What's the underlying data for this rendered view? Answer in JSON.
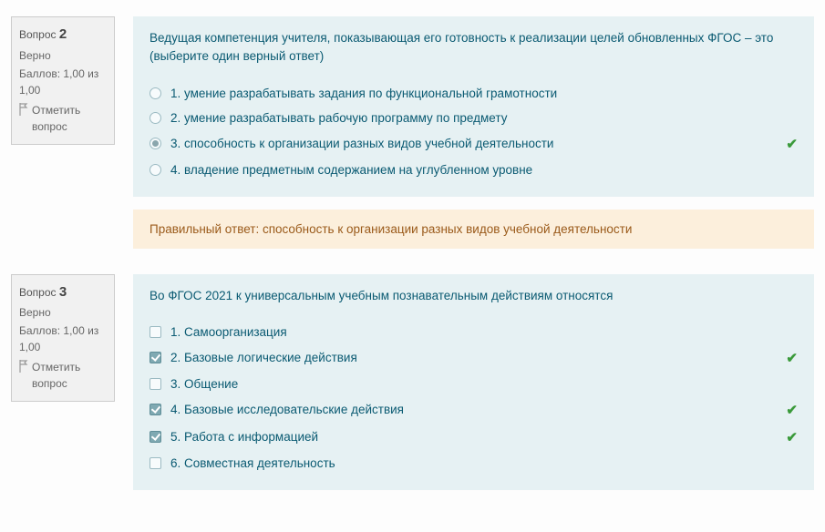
{
  "questions": [
    {
      "meta": {
        "label_prefix": "Вопрос",
        "number": "2",
        "status": "Верно",
        "score": "Баллов: 1,00 из 1,00",
        "flag": "Отметить вопрос"
      },
      "text": "Ведущая компетенция учителя, показывающая его готовность к реализации целей обновленных ФГОС – это (выберите один верный ответ)",
      "type": "radio",
      "options": [
        {
          "label": "1. умение разрабатывать задания по функциональной грамотности",
          "selected": false,
          "correct": false
        },
        {
          "label": "2. умение разрабатывать рабочую программу по предмету",
          "selected": false,
          "correct": false
        },
        {
          "label": "3. способность к организации разных видов учебной деятельности",
          "selected": true,
          "correct": true
        },
        {
          "label": "4. владение предметным содержанием на углубленном уровне",
          "selected": false,
          "correct": false
        }
      ],
      "feedback": "Правильный ответ: способность к организации разных видов учебной деятельности"
    },
    {
      "meta": {
        "label_prefix": "Вопрос",
        "number": "3",
        "status": "Верно",
        "score": "Баллов: 1,00 из 1,00",
        "flag": "Отметить вопрос"
      },
      "text": "Во ФГОС 2021 к универсальным учебным познавательным действиям относятся",
      "type": "checkbox",
      "options": [
        {
          "label": "1. Самоорганизация",
          "selected": false,
          "correct": false
        },
        {
          "label": "2. Базовые логические действия",
          "selected": true,
          "correct": true
        },
        {
          "label": "3. Общение",
          "selected": false,
          "correct": false
        },
        {
          "label": "4. Базовые исследовательские действия",
          "selected": true,
          "correct": true
        },
        {
          "label": "5. Работа с информацией",
          "selected": true,
          "correct": true
        },
        {
          "label": "6. Совместная деятельность",
          "selected": false,
          "correct": false
        }
      ],
      "feedback": ""
    }
  ]
}
